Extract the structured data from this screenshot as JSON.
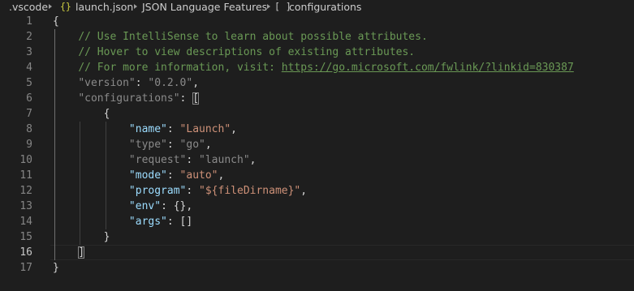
{
  "breadcrumb": {
    "folder": ".vscode",
    "file_icon": "{}",
    "file": "launch.json",
    "section": "JSON Language Features",
    "symbol_icon": "[ ]",
    "symbol": "configurations"
  },
  "editor": {
    "language": "json",
    "active_line": 16,
    "lines": [
      {
        "number": "1",
        "tokens": [
          {
            "text": "{",
            "type": "punct"
          }
        ]
      },
      {
        "number": "2",
        "tokens": [
          {
            "text": "    "
          },
          {
            "text": "// Use IntelliSense to learn about possible attributes.",
            "type": "comment"
          }
        ]
      },
      {
        "number": "3",
        "tokens": [
          {
            "text": "    "
          },
          {
            "text": "// Hover to view descriptions of existing attributes.",
            "type": "comment"
          }
        ]
      },
      {
        "number": "4",
        "tokens": [
          {
            "text": "    "
          },
          {
            "text": "// For more information, visit: ",
            "type": "comment"
          },
          {
            "text": "https://go.microsoft.com/fwlink/?linkid=830387",
            "type": "link"
          }
        ]
      },
      {
        "number": "5",
        "tokens": [
          {
            "text": "    "
          },
          {
            "text": "\"version\"",
            "type": "key-dim"
          },
          {
            "text": ": ",
            "type": "punct"
          },
          {
            "text": "\"0.2.0\"",
            "type": "str-dim"
          },
          {
            "text": ",",
            "type": "punct"
          }
        ]
      },
      {
        "number": "6",
        "tokens": [
          {
            "text": "    "
          },
          {
            "text": "\"configurations\"",
            "type": "key-dim"
          },
          {
            "text": ": ",
            "type": "punct"
          },
          {
            "text": "[",
            "type": "punct",
            "match": true
          }
        ]
      },
      {
        "number": "7",
        "tokens": [
          {
            "text": "        "
          },
          {
            "text": "{",
            "type": "punct"
          }
        ]
      },
      {
        "number": "8",
        "tokens": [
          {
            "text": "            "
          },
          {
            "text": "\"name\"",
            "type": "key"
          },
          {
            "text": ": ",
            "type": "punct"
          },
          {
            "text": "\"Launch\"",
            "type": "str"
          },
          {
            "text": ",",
            "type": "punct"
          }
        ]
      },
      {
        "number": "9",
        "tokens": [
          {
            "text": "            "
          },
          {
            "text": "\"type\"",
            "type": "key-dim"
          },
          {
            "text": ": ",
            "type": "punct"
          },
          {
            "text": "\"go\"",
            "type": "str-dim"
          },
          {
            "text": ",",
            "type": "punct"
          }
        ]
      },
      {
        "number": "10",
        "tokens": [
          {
            "text": "            "
          },
          {
            "text": "\"request\"",
            "type": "key-dim"
          },
          {
            "text": ": ",
            "type": "punct"
          },
          {
            "text": "\"launch\"",
            "type": "str-dim"
          },
          {
            "text": ",",
            "type": "punct"
          }
        ]
      },
      {
        "number": "11",
        "tokens": [
          {
            "text": "            "
          },
          {
            "text": "\"mode\"",
            "type": "key"
          },
          {
            "text": ": ",
            "type": "punct"
          },
          {
            "text": "\"auto\"",
            "type": "str"
          },
          {
            "text": ",",
            "type": "punct"
          }
        ]
      },
      {
        "number": "12",
        "tokens": [
          {
            "text": "            "
          },
          {
            "text": "\"program\"",
            "type": "key"
          },
          {
            "text": ": ",
            "type": "punct"
          },
          {
            "text": "\"${fileDirname}\"",
            "type": "str"
          },
          {
            "text": ",",
            "type": "punct"
          }
        ]
      },
      {
        "number": "13",
        "tokens": [
          {
            "text": "            "
          },
          {
            "text": "\"env\"",
            "type": "key"
          },
          {
            "text": ": {},",
            "type": "punct"
          }
        ]
      },
      {
        "number": "14",
        "tokens": [
          {
            "text": "            "
          },
          {
            "text": "\"args\"",
            "type": "key"
          },
          {
            "text": ": []",
            "type": "punct"
          }
        ]
      },
      {
        "number": "15",
        "tokens": [
          {
            "text": "        "
          },
          {
            "text": "}",
            "type": "punct"
          }
        ]
      },
      {
        "number": "16",
        "tokens": [
          {
            "text": "    "
          },
          {
            "text": "]",
            "type": "punct",
            "match": true
          }
        ]
      },
      {
        "number": "17",
        "tokens": [
          {
            "text": "}",
            "type": "punct"
          }
        ]
      }
    ]
  }
}
